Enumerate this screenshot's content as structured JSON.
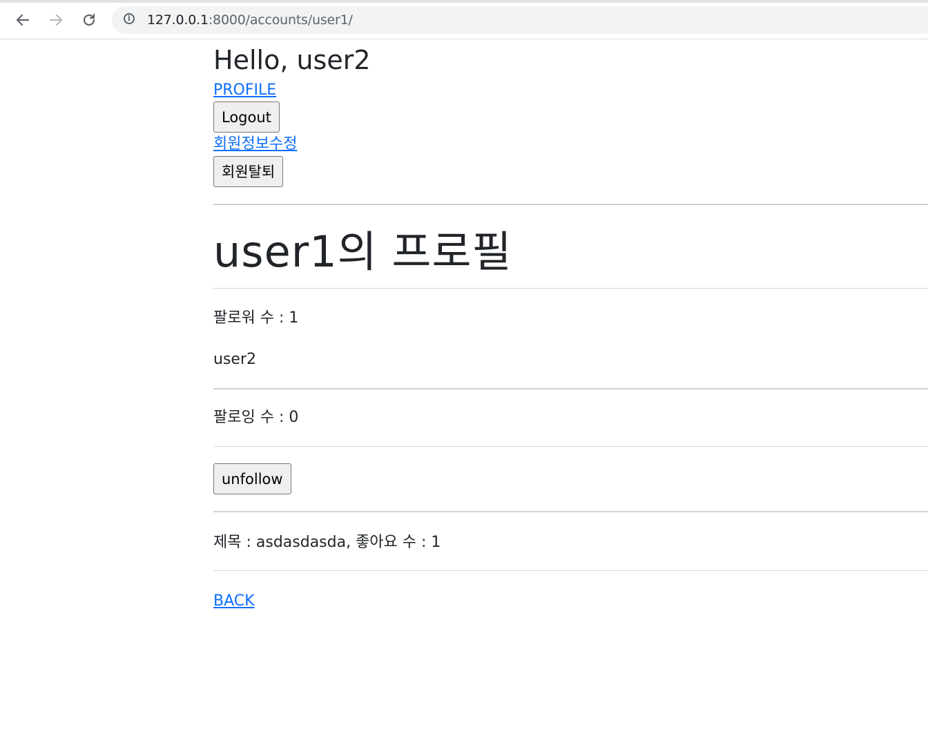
{
  "browser": {
    "url_host": "127.0.0.1",
    "url_path": ":8000/accounts/user1/",
    "back_icon": "arrow-left-icon",
    "forward_icon": "arrow-right-icon",
    "reload_icon": "reload-icon",
    "info_icon": "info-icon"
  },
  "header": {
    "greeting": "Hello, user2",
    "profile_link": "PROFILE",
    "logout_button": "Logout",
    "edit_account_link": "회원정보수정",
    "delete_account_button": "회원탈퇴"
  },
  "profile": {
    "title": "user1의 프로필",
    "followers_label": "팔로워 수 : 1",
    "followers": [
      "user2"
    ],
    "followings_label": "팔로잉 수 : 0",
    "follow_button": "unfollow",
    "articles": [
      {
        "text": "제목 : asdasdasda, 좋아요 수 : 1"
      }
    ],
    "back_link": "BACK"
  },
  "colors": {
    "link": "#0d6efd",
    "text": "#212529"
  }
}
